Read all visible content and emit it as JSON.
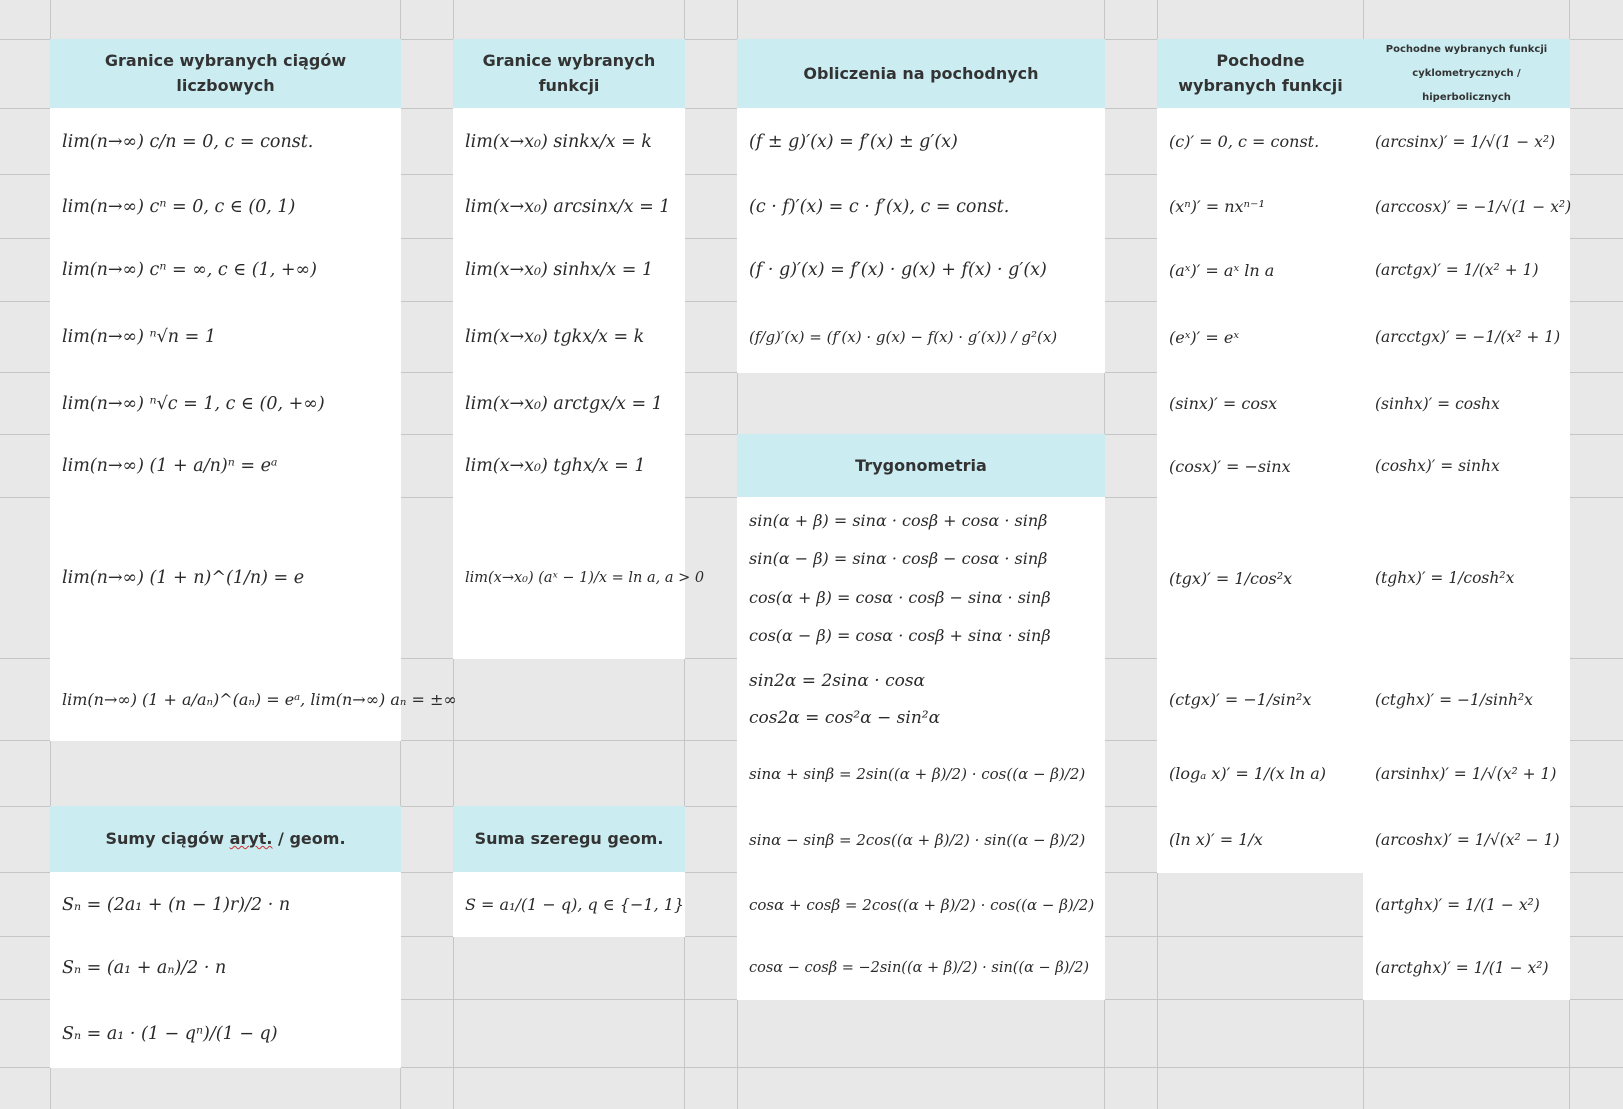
{
  "headers": {
    "granice_ciagow": "Granice wybranych ciągów liczbowych",
    "granice_funkcji": "Granice wybranych funkcji",
    "obliczenia": "Obliczenia na pochodnych",
    "pochodne": "Pochodne wybranych funkcji",
    "pochodne_cyklo_line1": "Pochodne wybranych funkcji",
    "pochodne_cyklo_line2": "cyklometrycznych / hiperbolicznych",
    "trygonometria": "Trygonometria",
    "sumy_ciagow_a": "Sumy ciągów ",
    "sumy_ciagow_b": "aryt.",
    "sumy_ciagow_c": " / geom.",
    "suma_szeregu": "Suma szeregu geom."
  },
  "ciagi": [
    "lim(n→∞) c/n = 0, c = const.",
    "lim(n→∞) cⁿ = 0, c ∈ (0, 1)",
    "lim(n→∞) cⁿ = ∞, c ∈ (1, +∞)",
    "lim(n→∞) ⁿ√n = 1",
    "lim(n→∞) ⁿ√c = 1, c ∈ (0, +∞)",
    "lim(n→∞) (1 + a/n)ⁿ = eᵃ",
    "lim(n→∞) (1 + n)^(1/n) = e",
    "lim(n→∞) (1 + a/aₙ)^(aₙ) = eᵃ, lim(n→∞) aₙ = ±∞"
  ],
  "funkcje": [
    "lim(x→x₀) sinkx/x = k",
    "lim(x→x₀) arcsinx/x = 1",
    "lim(x→x₀) sinhx/x = 1",
    "lim(x→x₀) tgkx/x = k",
    "lim(x→x₀) arctgx/x = 1",
    "lim(x→x₀) tghx/x = 1",
    "lim(x→x₀) (aˣ − 1)/x = ln a, a > 0"
  ],
  "obliczenia": [
    "(f ± g)′(x) = f′(x) ± g′(x)",
    "(c · f)′(x) = c · f′(x), c = const.",
    "(f · g)′(x) = f′(x) · g(x) + f(x) · g′(x)",
    "(f/g)′(x) = (f′(x) · g(x) − f(x) · g′(x)) / g²(x)"
  ],
  "tryg_block1": [
    "sin(α + β) = sinα · cosβ + cosα · sinβ",
    "sin(α − β) = sinα · cosβ − cosα · sinβ",
    "cos(α + β) = cosα · cosβ − sinα · sinβ",
    "cos(α − β) = cosα · cosβ + sinα · sinβ"
  ],
  "tryg_block2": [
    "sin2α = 2sinα · cosα",
    "cos2α = cos²α − sin²α"
  ],
  "tryg_sums": [
    "sinα + sinβ = 2sin((α + β)/2) · cos((α − β)/2)",
    "sinα − sinβ = 2cos((α + β)/2) · sin((α − β)/2)",
    "cosα + cosβ = 2cos((α + β)/2) · cos((α − β)/2)",
    "cosα − cosβ = −2sin((α + β)/2) · sin((α − β)/2)"
  ],
  "pochodne": [
    "(c)′ = 0, c = const.",
    "(xⁿ)′ = nxⁿ⁻¹",
    "(aˣ)′ = aˣ ln a",
    "(eˣ)′ = eˣ",
    "(sinx)′ = cosx",
    "(cosx)′ = −sinx",
    "(tgx)′ = 1/cos²x",
    "(ctgx)′ = −1/sin²x",
    "(logₐ x)′ = 1/(x ln a)",
    "(ln x)′ = 1/x"
  ],
  "cyklo": [
    "(arcsinx)′ = 1/√(1 − x²)",
    "(arccosx)′ = −1/√(1 − x²)",
    "(arctgx)′ = 1/(x² + 1)",
    "(arcctgx)′ = −1/(x² + 1)",
    "(sinhx)′ = coshx",
    "(coshx)′ = sinhx",
    "(tghx)′ = 1/cosh²x",
    "(ctghx)′ = −1/sinh²x",
    "(arsinhx)′ = 1/√(x² + 1)",
    "(arcoshx)′ = 1/√(x² − 1)",
    "(artghx)′ = 1/(1 − x²)",
    "(arctghx)′ = 1/(1 − x²)"
  ],
  "sumy": [
    "Sₙ = (2a₁ + (n − 1)r)/2 · n",
    "Sₙ = (a₁ + aₙ)/2 · n",
    "Sₙ = a₁ · (1 − qⁿ)/(1 − q)"
  ],
  "szereg": "S = a₁/(1 − q), q ∈ {−1, 1}"
}
